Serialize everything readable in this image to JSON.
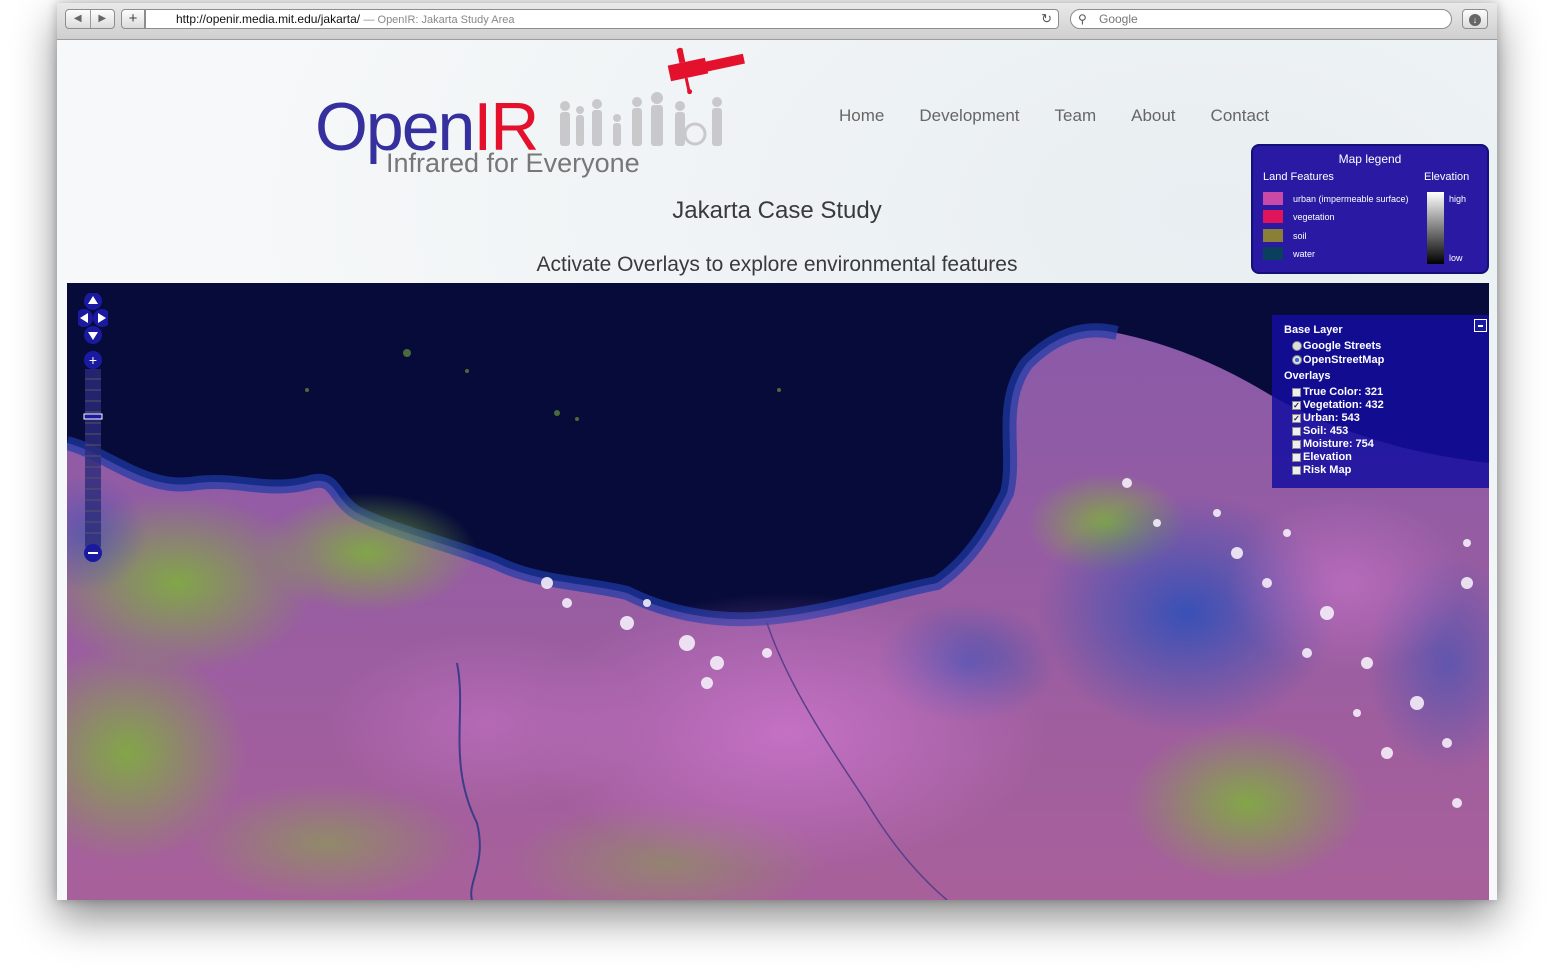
{
  "browser": {
    "back_icon": "◀",
    "forward_icon": "▶",
    "add_icon": "+",
    "url": "http://openir.media.mit.edu/jakarta/",
    "page_title": "— OpenIR: Jakarta Study Area",
    "search_placeholder": "Google"
  },
  "site": {
    "logo_open": "Open",
    "logo_ir": "IR",
    "tagline": "Infrared for Everyone",
    "nav": [
      "Home",
      "Development",
      "Team",
      "About",
      "Contact"
    ],
    "title": "Jakarta Case Study",
    "subtitle": "Activate Overlays to explore environmental features"
  },
  "legend": {
    "title": "Map legend",
    "land_header": "Land Features",
    "elev_header": "Elevation",
    "items": [
      {
        "label": "urban (impermeable surface)",
        "color": "#c94aa6"
      },
      {
        "label": "vegetation",
        "color": "#e0145a"
      },
      {
        "label": "soil",
        "color": "#8a7f37"
      },
      {
        "label": "water",
        "color": "#0a3f5e"
      }
    ],
    "high": "high",
    "low": "low"
  },
  "layer_switcher": {
    "base_header": "Base Layer",
    "base_layers": [
      {
        "label": "Google Streets",
        "selected": false
      },
      {
        "label": "OpenStreetMap",
        "selected": true
      }
    ],
    "overlays_header": "Overlays",
    "overlays": [
      {
        "label": "True Color: 321",
        "checked": false
      },
      {
        "label": "Vegetation: 432",
        "checked": true
      },
      {
        "label": "Urban: 543",
        "checked": true
      },
      {
        "label": "Soil: 453",
        "checked": false
      },
      {
        "label": "Moisture: 754",
        "checked": false
      },
      {
        "label": "Elevation",
        "checked": false
      },
      {
        "label": "Risk Map",
        "checked": false
      }
    ]
  },
  "colors": {
    "brand_blue": "#35309e",
    "brand_red": "#e4112d",
    "legend_bg": "#2a1aa3",
    "sea": "#0b0f45",
    "urban": "#b05ab8",
    "vegetation": "#6ea84a"
  }
}
